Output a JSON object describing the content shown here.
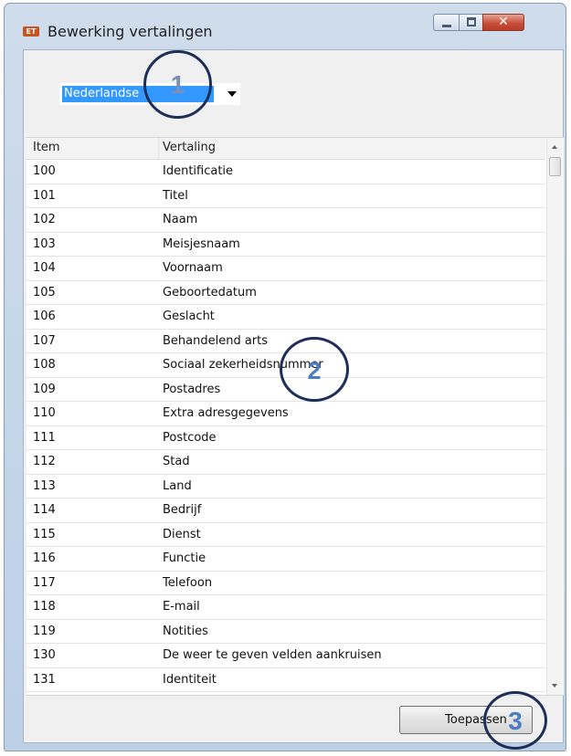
{
  "window": {
    "title": "Bewerking vertalingen",
    "app_icon_text": "ET"
  },
  "language_select": {
    "selected": "Nederlandse"
  },
  "grid": {
    "columns": [
      "Item",
      "Vertaling"
    ],
    "rows": [
      {
        "item": "100",
        "vertaling": "Identificatie"
      },
      {
        "item": "101",
        "vertaling": "Titel"
      },
      {
        "item": "102",
        "vertaling": "Naam"
      },
      {
        "item": "103",
        "vertaling": "Meisjesnaam"
      },
      {
        "item": "104",
        "vertaling": "Voornaam"
      },
      {
        "item": "105",
        "vertaling": "Geboortedatum"
      },
      {
        "item": "106",
        "vertaling": "Geslacht"
      },
      {
        "item": "107",
        "vertaling": "Behandelend arts"
      },
      {
        "item": "108",
        "vertaling": "Sociaal zekerheidsnummer"
      },
      {
        "item": "109",
        "vertaling": "Postadres"
      },
      {
        "item": "110",
        "vertaling": "Extra adresgegevens"
      },
      {
        "item": "111",
        "vertaling": "Postcode"
      },
      {
        "item": "112",
        "vertaling": "Stad"
      },
      {
        "item": "113",
        "vertaling": "Land"
      },
      {
        "item": "114",
        "vertaling": "Bedrijf"
      },
      {
        "item": "115",
        "vertaling": "Dienst"
      },
      {
        "item": "116",
        "vertaling": "Functie"
      },
      {
        "item": "117",
        "vertaling": "Telefoon"
      },
      {
        "item": "118",
        "vertaling": "E-mail"
      },
      {
        "item": "119",
        "vertaling": "Notities"
      },
      {
        "item": "130",
        "vertaling": "De weer te geven velden aankruisen"
      },
      {
        "item": "131",
        "vertaling": "Identiteit"
      }
    ]
  },
  "apply_button": {
    "label": "Toepassen"
  },
  "callouts": [
    "1",
    "2",
    "3"
  ],
  "colors": {
    "selection": "#3399ff",
    "callout_ring": "#1d2f59",
    "callout_number": "#4b7cc4",
    "close_button": "#c7503a"
  }
}
